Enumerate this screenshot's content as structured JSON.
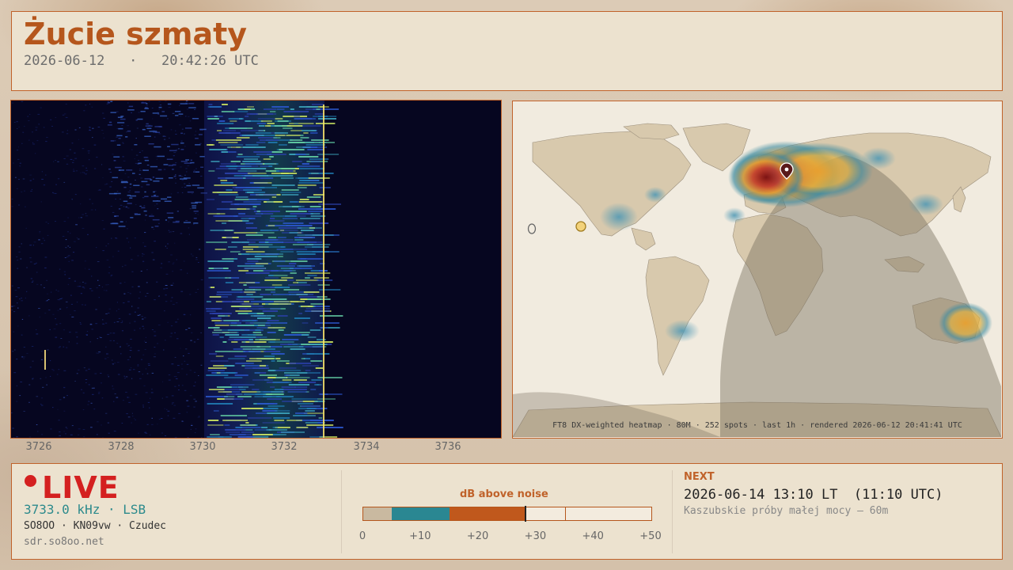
{
  "header": {
    "title": "Żucie szmaty",
    "date": "2026-06-12",
    "separator": "·",
    "time": "20:42:26 UTC"
  },
  "waterfall": {
    "freq_ticks": [
      "3726",
      "3728",
      "3730",
      "3732",
      "3734",
      "3736"
    ]
  },
  "map": {
    "caption": "FT8 DX-weighted heatmap · 80M · 252 spots · last 1h · rendered 2026-06-12 20:41:41 UTC"
  },
  "footer": {
    "live_label": "LIVE",
    "frequency": "3733.0 kHz · LSB",
    "station": "SO8OO · KN09vw · Czudec",
    "url": "sdr.so8oo.net",
    "meter": {
      "label": "dB above noise",
      "ticks": [
        "0",
        "+10",
        "+20",
        "+30",
        "+40",
        "+50"
      ],
      "segments": [
        {
          "from": 0,
          "to": 5,
          "color": "#c9b9a0"
        },
        {
          "from": 5,
          "to": 15,
          "color": "#2a8792"
        },
        {
          "from": 15,
          "to": 28,
          "color": "#c0581c"
        }
      ],
      "current_db": 28,
      "peak_db": 35
    },
    "next": {
      "label": "NEXT",
      "time": "2026-06-14 13:10 LT  (11:10 UTC)",
      "description": "Kaszubskie próby małej mocy — 60m"
    }
  },
  "colors": {
    "accent": "#c0622a",
    "live": "#d42020",
    "teal": "#2c8a8c"
  }
}
